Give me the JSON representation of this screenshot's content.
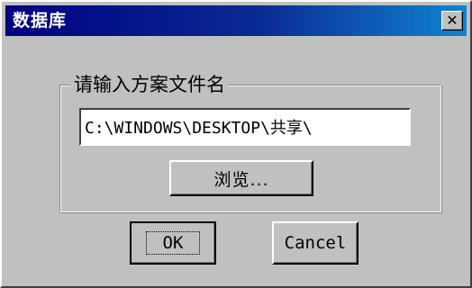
{
  "window": {
    "title": "数据库",
    "close_icon": "close-icon"
  },
  "group": {
    "label": "请输入方案文件名"
  },
  "path": {
    "value": "C:\\WINDOWS\\DESKTOP\\共享\\"
  },
  "buttons": {
    "browse_label": "浏览...",
    "ok_label": "OK",
    "cancel_label": "Cancel"
  },
  "colors": {
    "titlebar_start": "#000080",
    "titlebar_end": "#1084d0",
    "face": "#c0c0c0"
  }
}
